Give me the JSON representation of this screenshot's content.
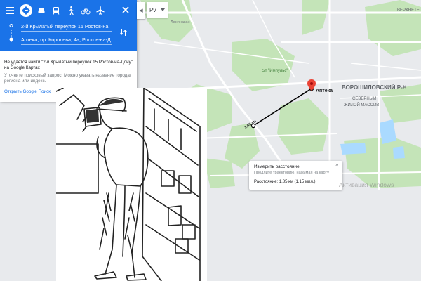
{
  "app": {
    "modes": [
      {
        "name": "directions-icon"
      },
      {
        "name": "car-icon"
      },
      {
        "name": "transit-icon"
      },
      {
        "name": "walk-icon"
      },
      {
        "name": "bike-icon"
      },
      {
        "name": "flight-icon"
      }
    ]
  },
  "route": {
    "from": "2-й Крылатый переулок 15 Ростов-на",
    "to": "Аптека, пр. Королева, 4а, Ростов-на-Д"
  },
  "panel": {
    "error_text": "Не удается найти \"2-й Крылатый переулок 15 Ростов-на-Дону\" на Google Картах",
    "hint_text": "Уточните поисковый запрос. Можно указать название города/региона или индекс.",
    "link_text": "Открыть Google Поиск"
  },
  "map_controls": {
    "language_value": "Рv"
  },
  "map": {
    "labels": {
      "district": "ВОРОШИЛОВСКИЙ Р-Н",
      "massif_line1": "СЕВЕРНЫЙ",
      "massif_line2": "ЖИЛОЙ МАССИВ",
      "pharmacy": "Аптека",
      "park": "с/т \"Импульс\"",
      "distance_on_path": "1.85 км",
      "top_right": "ВЕРХНЕТЕ",
      "leninakan": "Ленинакан",
      "edge_n": "Н"
    },
    "colors": {
      "background": "#e8eaed",
      "green": "#c4e4b8",
      "water": "#aadaff",
      "road": "#ffffff",
      "pin": "#ea4335"
    }
  },
  "measure": {
    "title": "Измерить расстояние",
    "hint": "Продлите траекторию, нажимая на карту",
    "distance": "Расстояние: 1,85 км (1,15 мил.)"
  },
  "watermark": "Активация Windows"
}
